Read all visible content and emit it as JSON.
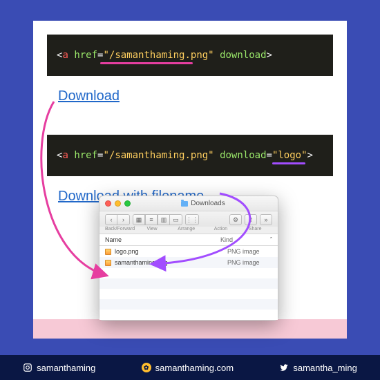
{
  "code1": {
    "open": "<",
    "tag": "a",
    "sp": " ",
    "attr1": "href",
    "eq": "=",
    "val1": "\"/samanthaming.png\"",
    "attr2": "download",
    "close": ">"
  },
  "link1": "Download",
  "code2": {
    "open": "<",
    "tag": "a",
    "sp": " ",
    "attr1": "href",
    "eq": "=",
    "val1": "\"/samanthaming.png\"",
    "attr2": "download",
    "val2": "\"logo\"",
    "close": ">"
  },
  "link2": "Download with filename",
  "finder": {
    "title": "Downloads",
    "labels": {
      "back": "Back/Forward",
      "view": "View",
      "arrange": "Arrange",
      "action": "Action",
      "share": "Share"
    },
    "header": {
      "name": "Name",
      "kind": "Kind"
    },
    "rows": [
      {
        "name": "logo.png",
        "kind": "PNG image"
      },
      {
        "name": "samanthaming.png",
        "kind": "PNG image"
      }
    ]
  },
  "footer": {
    "instagram": "samanthaming",
    "site": "samanthaming.com",
    "twitter": "samantha_ming"
  }
}
